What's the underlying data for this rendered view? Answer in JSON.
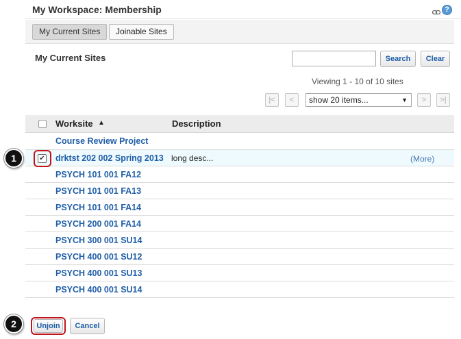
{
  "header": {
    "title": "My Workspace: Membership",
    "help_glyph": "?"
  },
  "tabs": [
    {
      "label": "My Current Sites",
      "active": true
    },
    {
      "label": "Joinable Sites",
      "active": false
    }
  ],
  "section": {
    "heading": "My Current Sites"
  },
  "search": {
    "value": "",
    "search_label": "Search",
    "clear_label": "Clear"
  },
  "pager": {
    "viewing_text": "Viewing 1 - 10 of 10 sites",
    "first_label": "|<",
    "prev_label": "<",
    "next_label": ">",
    "last_label": ">|",
    "page_size_selected": "show 20 items..."
  },
  "table": {
    "columns": [
      "Worksite",
      "Description"
    ],
    "sort_glyph": "▲",
    "rows": [
      {
        "site": "Course Review Project",
        "description": "",
        "more": "",
        "checked": false
      },
      {
        "site": "drktst 202 002 Spring 2013",
        "description": "long desc...",
        "more": "(More)",
        "checked": true
      },
      {
        "site": "PSYCH 101 001 FA12",
        "description": "",
        "more": "",
        "checked": false
      },
      {
        "site": "PSYCH 101 001 FA13",
        "description": "",
        "more": "",
        "checked": false
      },
      {
        "site": "PSYCH 101 001 FA14",
        "description": "",
        "more": "",
        "checked": false
      },
      {
        "site": "PSYCH 200 001 FA14",
        "description": "",
        "more": "",
        "checked": false
      },
      {
        "site": "PSYCH 300 001 SU14",
        "description": "",
        "more": "",
        "checked": false
      },
      {
        "site": "PSYCH 400 001 SU12",
        "description": "",
        "more": "",
        "checked": false
      },
      {
        "site": "PSYCH 400 001 SU13",
        "description": "",
        "more": "",
        "checked": false
      },
      {
        "site": "PSYCH 400 001 SU14",
        "description": "",
        "more": "",
        "checked": false
      }
    ]
  },
  "actions": {
    "unjoin_label": "Unjoin",
    "cancel_label": "Cancel"
  },
  "annotations": {
    "step1": "1",
    "step2": "2"
  },
  "colors": {
    "link": "#1f5ea8",
    "callout": "#c0161b",
    "selected_row": "#eefafd"
  },
  "icons": {
    "link": "link-icon",
    "help": "help-icon",
    "sort": "sort-ascending-icon"
  }
}
